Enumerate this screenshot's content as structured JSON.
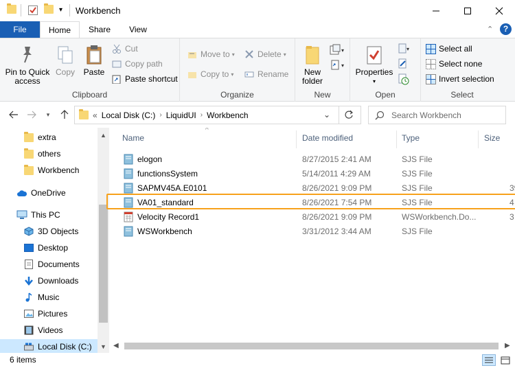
{
  "window": {
    "title": "Workbench"
  },
  "tabs": {
    "file": "File",
    "home": "Home",
    "share": "Share",
    "view": "View"
  },
  "ribbon": {
    "clipboard": {
      "label": "Clipboard",
      "pin_line1": "Pin to Quick",
      "pin_line2": "access",
      "copy": "Copy",
      "paste": "Paste",
      "cut": "Cut",
      "copy_path": "Copy path",
      "paste_shortcut": "Paste shortcut"
    },
    "organize": {
      "label": "Organize",
      "move_to": "Move to",
      "delete": "Delete",
      "copy_to": "Copy to",
      "rename": "Rename"
    },
    "new": {
      "label": "New",
      "new_folder_line1": "New",
      "new_folder_line2": "folder"
    },
    "open": {
      "label": "Open",
      "properties": "Properties"
    },
    "select": {
      "label": "Select",
      "select_all": "Select all",
      "select_none": "Select none",
      "invert": "Invert selection"
    }
  },
  "address": {
    "overflow": "«",
    "crumbs": [
      "Local Disk (C:)",
      "LiquidUI",
      "Workbench"
    ]
  },
  "search": {
    "placeholder": "Search Workbench"
  },
  "navpane": {
    "items": [
      {
        "label": "extra",
        "icon": "folder-icon"
      },
      {
        "label": "others",
        "icon": "folder-icon"
      },
      {
        "label": "Workbench",
        "icon": "folder-icon"
      },
      {
        "label": "OneDrive",
        "icon": "cloud-icon"
      },
      {
        "label": "This PC",
        "icon": "computer-icon"
      },
      {
        "label": "3D Objects",
        "icon": "cube-icon"
      },
      {
        "label": "Desktop",
        "icon": "desktop-icon"
      },
      {
        "label": "Documents",
        "icon": "document-icon"
      },
      {
        "label": "Downloads",
        "icon": "download-icon"
      },
      {
        "label": "Music",
        "icon": "music-icon"
      },
      {
        "label": "Pictures",
        "icon": "picture-icon"
      },
      {
        "label": "Videos",
        "icon": "video-icon"
      },
      {
        "label": "Local Disk (C:)",
        "icon": "drive-icon"
      }
    ]
  },
  "columns": {
    "name": "Name",
    "date": "Date modified",
    "type": "Type",
    "size": "Size"
  },
  "files": [
    {
      "name": "elogon",
      "date": "8/27/2015 2:41 AM",
      "type": "SJS File",
      "size": ""
    },
    {
      "name": "functionsSystem",
      "date": "5/14/2011 4:29 AM",
      "type": "SJS File",
      "size": ""
    },
    {
      "name": "SAPMV45A.E0101",
      "date": "8/26/2021 9:09 PM",
      "type": "SJS File",
      "size": "39"
    },
    {
      "name": "VA01_standard",
      "date": "8/26/2021 7:54 PM",
      "type": "SJS File",
      "size": "4"
    },
    {
      "name": "Velocity Record1",
      "date": "8/26/2021 9:09 PM",
      "type": "WSWorkbench.Do...",
      "size": "3"
    },
    {
      "name": "WSWorkbench",
      "date": "3/31/2012 3:44 AM",
      "type": "SJS File",
      "size": ""
    }
  ],
  "status": {
    "items": "6 items"
  },
  "colors": {
    "accent": "#1a5fb4",
    "highlight": "#f7a11a",
    "selected": "#cce8ff"
  }
}
